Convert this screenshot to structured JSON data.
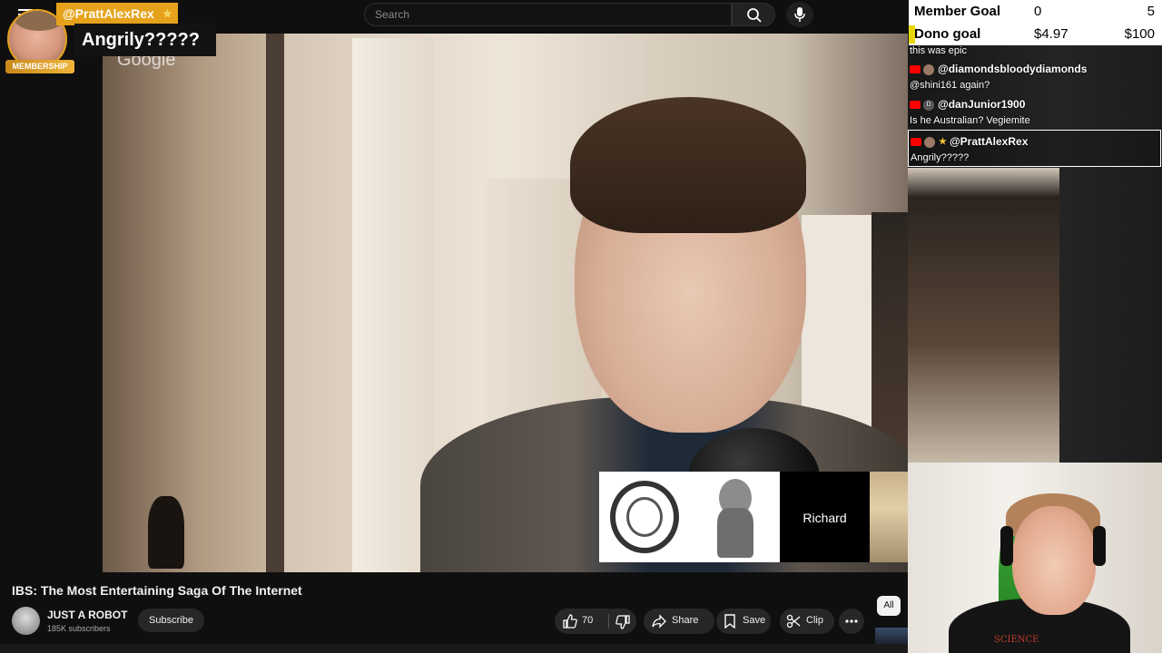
{
  "top_bar": {
    "search_placeholder": "Search"
  },
  "membership_alert": {
    "handle": "@PrattAlexRex",
    "badge": "MEMBERSHIP",
    "message": "Angrily?????"
  },
  "video": {
    "watermark": "Google",
    "lower_third_name": "Richard",
    "title": "IBS: The Most Entertaining Saga Of The Internet"
  },
  "channel": {
    "name": "JUST A ROBOT",
    "subscribers": "185K subscribers",
    "subscribe_label": "Subscribe"
  },
  "actions": {
    "like_count": "70",
    "share_label": "Share",
    "save_label": "Save",
    "clip_label": "Clip"
  },
  "chips": {
    "all_label": "All"
  },
  "goals": {
    "member_goal_label": "Member Goal",
    "member_goal_current": "0",
    "member_goal_target": "5",
    "dono_goal_label": "Dono goal",
    "dono_goal_current": "$4.97",
    "dono_goal_target": "$100"
  },
  "chat": {
    "messages": [
      {
        "user": "",
        "text": "this was epic"
      },
      {
        "user": "@diamondsbloodydiamonds",
        "text": "@shini161 again?"
      },
      {
        "user": "@danJunior1900",
        "text": "Is he Australian? Vegiemite",
        "avatar_letter": "D"
      },
      {
        "user": "@PrattAlexRex",
        "text": "Angrily?????"
      }
    ]
  },
  "webcam": {
    "shirt_text": "SCIENCE"
  },
  "colors": {
    "membership_gold": "#e6a21a",
    "goal_bar_yellow": "#e8d80a",
    "youtube_red": "#ff0000"
  },
  "icons": [
    "menu-icon",
    "search-icon",
    "mic-icon",
    "thumbs-up-icon",
    "thumbs-down-icon",
    "share-icon",
    "save-icon",
    "clip-icon",
    "more-icon",
    "youtube-icon",
    "star-icon"
  ]
}
